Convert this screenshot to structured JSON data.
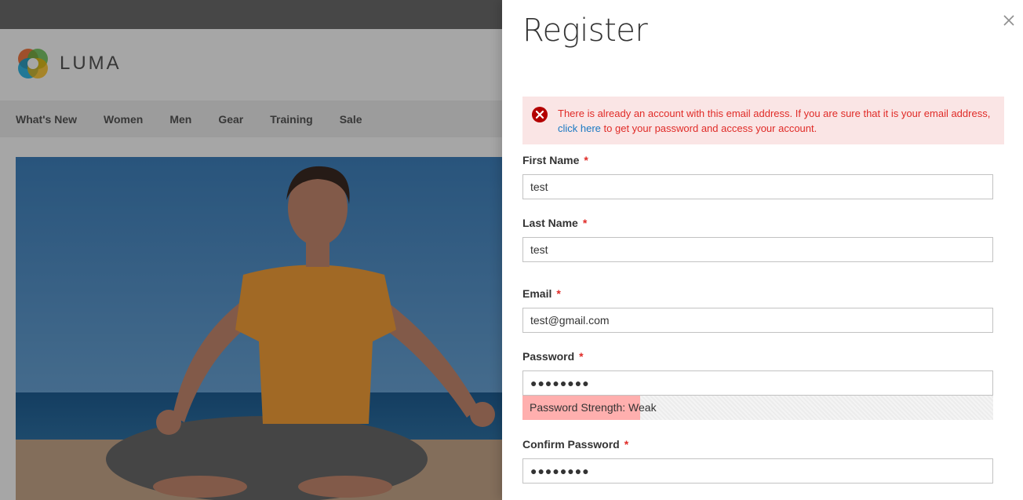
{
  "store": {
    "logo_text": "LUMA",
    "nav": [
      "What's New",
      "Women",
      "Men",
      "Gear",
      "Training",
      "Sale"
    ]
  },
  "modal": {
    "title": "Register",
    "error": {
      "text_before": "There is already an account with this email address. If you are sure that it is your email address, ",
      "link_text": "click here",
      "text_after": " to get your password and access your account."
    },
    "fields": {
      "first_name": {
        "label": "First Name",
        "value": "test"
      },
      "last_name": {
        "label": "Last Name",
        "value": "test"
      },
      "email": {
        "label": "Email",
        "value": "test@gmail.com"
      },
      "password": {
        "label": "Password",
        "value": "●●●●●●●●"
      },
      "confirm_password": {
        "label": "Confirm Password",
        "value": "●●●●●●●●"
      }
    },
    "required_mark": "*",
    "password_strength": {
      "text": "Password Strength: Weak",
      "level": 0.25,
      "color": "#ffafae"
    }
  },
  "colors": {
    "error_bg": "#fae5e5",
    "error_text": "#e02b27",
    "link": "#1979c3"
  }
}
